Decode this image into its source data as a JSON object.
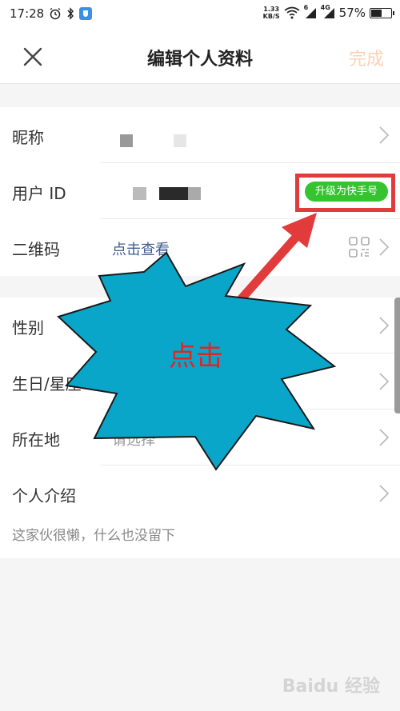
{
  "status_bar": {
    "time": "17:28",
    "net_speed_value": "1.33",
    "net_speed_unit": "KB/S",
    "signal_label_1": "6",
    "signal_label_2": "4G",
    "battery_percent": "57%",
    "battery_level": 0.57
  },
  "nav": {
    "title": "编辑个人资料",
    "done_label": "完成",
    "done_color": "#fbd2b6"
  },
  "profile": {
    "nickname_label": "昵称",
    "user_id_label": "用户 ID",
    "upgrade_label": "升级为快手号",
    "qrcode_label": "二维码",
    "qrcode_value": "点击查看",
    "gender_label": "性别",
    "birthday_label": "生日/星座",
    "location_label": "所在地",
    "location_placeholder": "请选择",
    "intro_label": "个人介绍",
    "intro_text": "这家伙很懒，什么也没留下"
  },
  "annotation": {
    "burst_text": "点击",
    "burst_color": "#0aa6c9",
    "arrow_color": "#e23b3b",
    "frame_color": "#e23b3b"
  },
  "watermark": {
    "text": "Baidu 经验"
  },
  "colors": {
    "upgrade_button": "#35c42f",
    "link_blue": "#3f5d8f"
  }
}
